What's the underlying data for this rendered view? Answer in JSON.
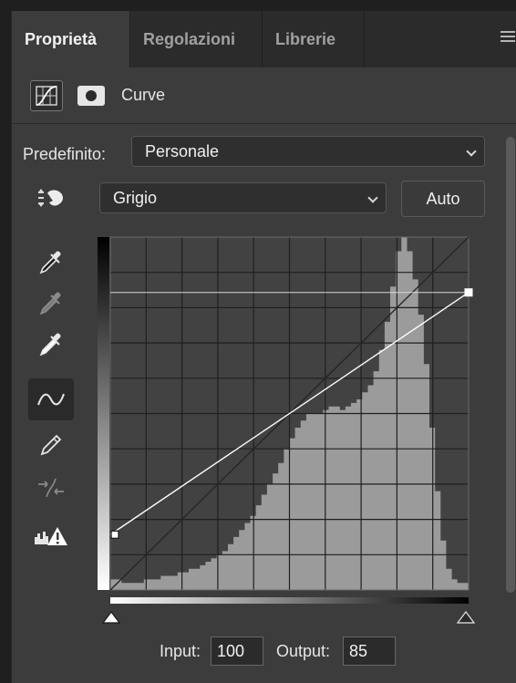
{
  "tabs": [
    {
      "label": "Proprietà",
      "active": true
    },
    {
      "label": "Regolazioni",
      "active": false
    },
    {
      "label": "Librerie",
      "active": false
    }
  ],
  "panel": {
    "title": "Curve",
    "icons": [
      "curves-adjustment-icon",
      "layer-mask-icon"
    ]
  },
  "preset": {
    "label": "Predefinito:",
    "value": "Personale"
  },
  "channel": {
    "value": "Grigio"
  },
  "auto_label": "Auto",
  "tools": [
    "on-image-adjust-icon",
    "black-point-eyedropper-icon",
    "gray-point-eyedropper-icon",
    "white-point-eyedropper-icon",
    "edit-points-curve-icon",
    "draw-curve-pencil-icon",
    "smooth-curve-icon",
    "clipping-warning-icon"
  ],
  "curve": {
    "input_range": [
      0,
      255
    ],
    "output_range": [
      0,
      255
    ],
    "points": [
      {
        "input": 0,
        "output": 40
      },
      {
        "input": 255,
        "output": 215
      }
    ],
    "histogram": [
      3,
      3,
      2,
      2,
      2,
      2,
      3,
      3,
      3,
      4,
      4,
      4,
      5,
      5,
      6,
      6,
      7,
      8,
      9,
      10,
      11,
      13,
      15,
      17,
      19,
      21,
      24,
      27,
      30,
      33,
      36,
      40,
      43,
      46,
      48,
      50,
      50,
      50,
      51,
      52,
      52,
      51,
      52,
      53,
      54,
      56,
      58,
      62,
      68,
      76,
      86,
      96,
      100,
      96,
      88,
      78,
      64,
      46,
      28,
      14,
      6,
      3,
      2,
      2
    ]
  },
  "io": {
    "input_label": "Input:",
    "input_value": "100",
    "output_label": "Output:",
    "output_value": "85"
  },
  "colors": {
    "panel_bg": "#3c3c3c",
    "tab_bar_bg": "#2b2b2b",
    "graph_bg": "#424242",
    "histogram": "#9b9b9b",
    "curve": "#ffffff"
  }
}
